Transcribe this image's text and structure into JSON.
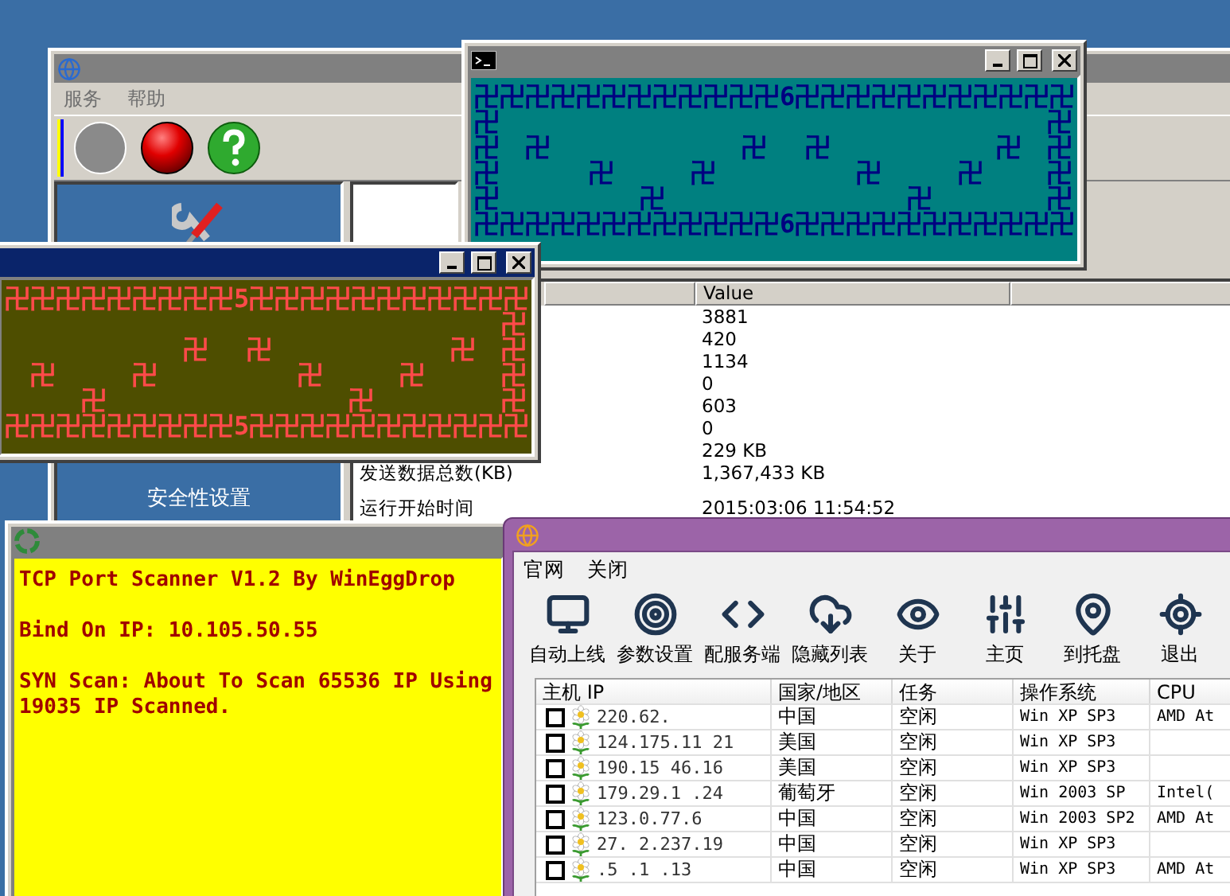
{
  "service_window": {
    "menu": [
      "服务",
      "帮助"
    ],
    "side_panel": {
      "label": "安全性设置"
    },
    "stats": {
      "value_heading": "Value",
      "groups": [
        [
          {
            "value": "3881"
          },
          {
            "value": "420"
          },
          {
            "value": "1134"
          },
          {
            "value": "0"
          },
          {
            "value": "603"
          },
          {
            "value": "0"
          },
          {
            "value": "229 KB"
          },
          {
            "label": "发送数据总数(KB)",
            "value": "1,367,433 KB"
          }
        ],
        [
          {
            "label": "运行开始时间",
            "value": "2015:03:06  11:54:52"
          }
        ]
      ]
    }
  },
  "teal_console": {
    "lines": [
      "卍卍卍卍卍卍卍卍卍卍卍卍6卍卍卍卍卍卍卍卍卍卍卍",
      "卍                                           卍",
      "卍  卍               卍   卍             卍  卍",
      "卍       卍      卍           卍      卍     卍",
      "卍           卍                   卍         卍",
      "卍卍卍卍卍卍卍卍卍卍卍卍6卍卍卍卍卍卍卍卍卍卍卍"
    ]
  },
  "olive_console": {
    "lines": [
      "卍卍卍卍卍卍卍卍卍5卍卍卍卍卍卍卍卍卍卍卍",
      "                                       卍",
      "              卍   卍              卍  卍",
      "  卍      卍           卍      卍      卍",
      "      卍                   卍          卍",
      "卍卍卍卍卍卍卍卍卍5卍卍卍卍卍卍卍卍卍卍卍"
    ]
  },
  "scanner_console": {
    "paragraphs": [
      [
        "TCP Port Scanner V1.2 By WinEggDrop"
      ],
      [
        "Bind On IP: 10.105.50.55"
      ],
      [
        "SYN Scan: About To Scan 65536 IP Using",
        "19035 IP Scanned."
      ]
    ]
  },
  "client_manager": {
    "menu": [
      "官网",
      "关闭"
    ],
    "toolbar": [
      "自动上线",
      "参数设置",
      "配服务端",
      "隐藏列表",
      "关于",
      "主页",
      "到托盘",
      "退出"
    ],
    "table": {
      "columns": [
        "主机 IP",
        "国家/地区",
        "任务",
        "操作系统",
        "CPU"
      ],
      "rows": [
        {
          "checked": false,
          "ip": "220.62.",
          "country": "中国",
          "task": "空闲",
          "os": "Win XP SP3",
          "cpu": "AMD At"
        },
        {
          "checked": false,
          "ip": "124.175.11  21",
          "country": "美国",
          "task": "空闲",
          "os": "Win XP SP3"
        },
        {
          "checked": false,
          "ip": "190.15  46.16",
          "country": "美国",
          "task": "空闲",
          "os": "Win XP SP3"
        },
        {
          "checked": false,
          "ip": "179.29.1 .24",
          "country": "葡萄牙",
          "task": "空闲",
          "os": "Win 2003 SP",
          "cpu": "Intel("
        },
        {
          "checked": false,
          "ip": "123.0.77.6",
          "country": "中国",
          "task": "空闲",
          "os": "Win 2003 SP2",
          "cpu": "AMD At"
        },
        {
          "checked": false,
          "ip": "27. 2.237.19",
          "country": "中国",
          "task": "空闲",
          "os": "Win XP SP3"
        },
        {
          "checked": false,
          "ip": " .5 .1 .13",
          "country": "中国",
          "task": "空闲",
          "os": "Win XP SP3",
          "cpu": "AMD At"
        }
      ]
    }
  }
}
